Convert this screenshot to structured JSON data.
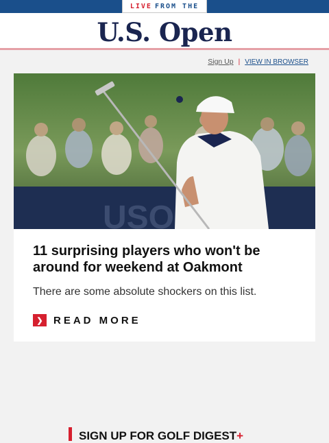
{
  "topbar": {
    "live_word": "LIVE",
    "rest": "FROM THE"
  },
  "masthead": {
    "logo": "U.S. Open"
  },
  "utility": {
    "signup": "Sign Up",
    "separator": "|",
    "view_in_browser": "VIEW IN BROWSER"
  },
  "hero": {
    "banner_text": "USOPEN"
  },
  "article": {
    "headline": "11 surprising players who won't be around for weekend at Oakmont",
    "dek": "There are some absolute shockers on this list.",
    "cta_icon": "chevron-right-icon",
    "cta": "READ MORE"
  },
  "signup_section": {
    "title": "SIGN UP FOR GOLF DIGEST",
    "plus": "+"
  },
  "colors": {
    "brand_blue": "#1a4f8b",
    "accent_red": "#d6202f",
    "navy": "#1a2550"
  }
}
